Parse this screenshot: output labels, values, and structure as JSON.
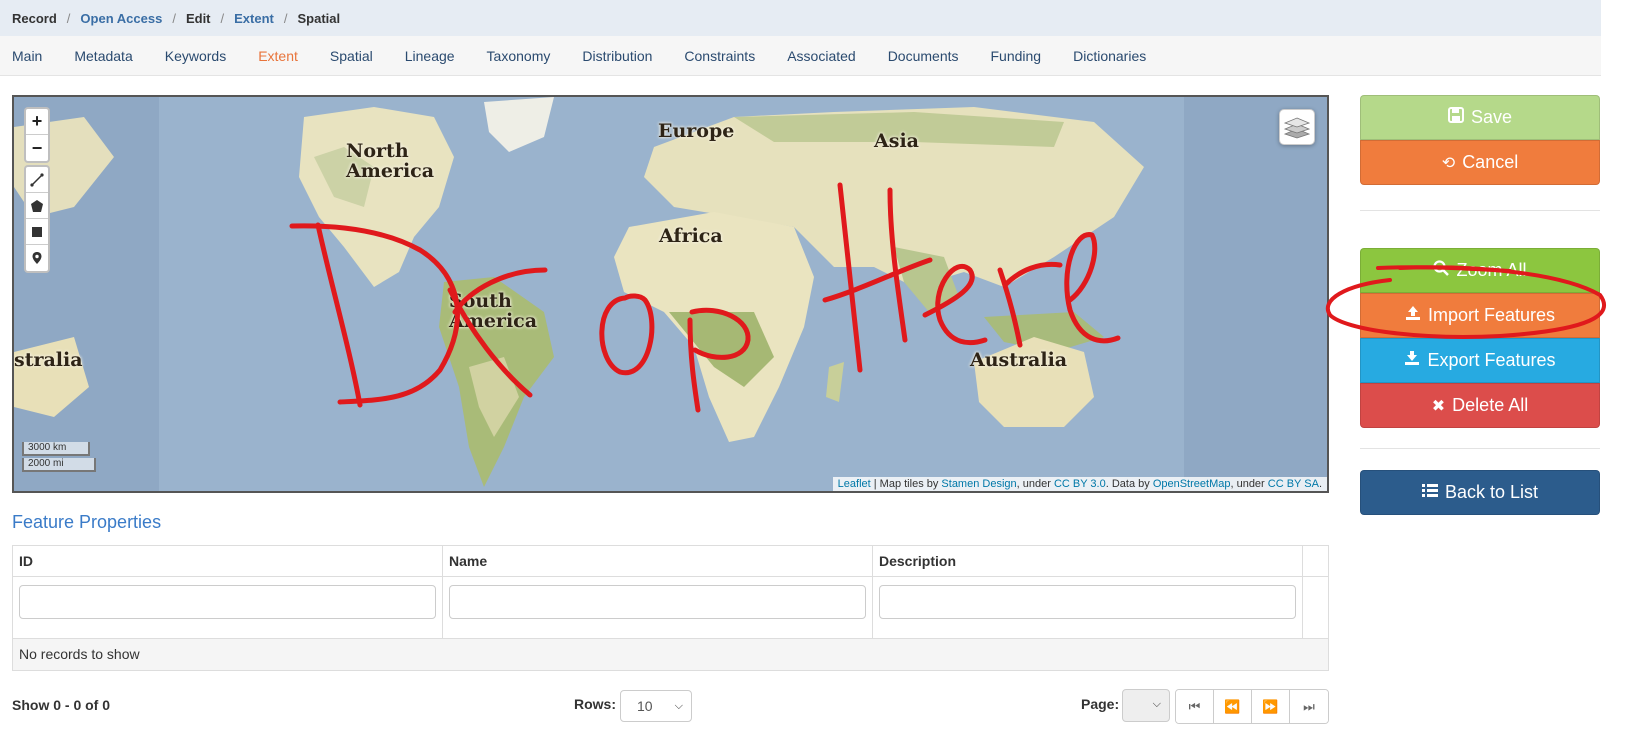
{
  "breadcrumb": {
    "items": [
      "Record",
      "Open Access",
      "Edit",
      "Extent",
      "Spatial"
    ],
    "separator": "/"
  },
  "tabs": [
    "Main",
    "Metadata",
    "Keywords",
    "Extent",
    "Spatial",
    "Lineage",
    "Taxonomy",
    "Distribution",
    "Constraints",
    "Associated",
    "Documents",
    "Funding",
    "Dictionaries"
  ],
  "active_tab": "Extent",
  "map": {
    "labels": {
      "north_america_1": "North",
      "north_america_2": "America",
      "europe": "Europe",
      "asia": "Asia",
      "africa": "Africa",
      "south_america_1": "South",
      "south_america_2": "America",
      "australia": "Australia",
      "australia_left": "stralia"
    },
    "zoom_in": "+",
    "zoom_out": "−",
    "scale_km": "3000 km",
    "scale_mi": "2000 mi",
    "attribution": {
      "leaflet": "Leaflet",
      "t1": " | Map tiles by ",
      "stamen": "Stamen Design",
      "t2": ", under ",
      "ccby30": "CC BY 3.0",
      "t3": ". Data by ",
      "osm": "OpenStreetMap",
      "t4": ", under ",
      "ccbysa": "CC BY SA",
      "t5": "."
    },
    "handwriting": "Drop Here"
  },
  "feature_properties": {
    "title": "Feature Properties",
    "columns": [
      "ID",
      "Name",
      "Description"
    ],
    "empty_text": "No records to show"
  },
  "pager": {
    "info": "Show 0 - 0 of 0",
    "rows_label": "Rows:",
    "rows_value": "10",
    "page_label": "Page:"
  },
  "sidebar": {
    "save": "Save",
    "cancel": "Cancel",
    "zoom_all": "Zoom All",
    "import": "Import Features",
    "export": "Export Features",
    "delete_all": "Delete All",
    "back": "Back to List"
  },
  "colors": {
    "accent_tab": "#e8743b",
    "annotation_red": "#e0191c",
    "save": "#b5d98a",
    "cancel": "#f07c3d",
    "zoom": "#8cc63f",
    "import": "#f07c3d",
    "export": "#27aae1",
    "delete": "#dc4d4b",
    "back": "#2c5c8c"
  }
}
